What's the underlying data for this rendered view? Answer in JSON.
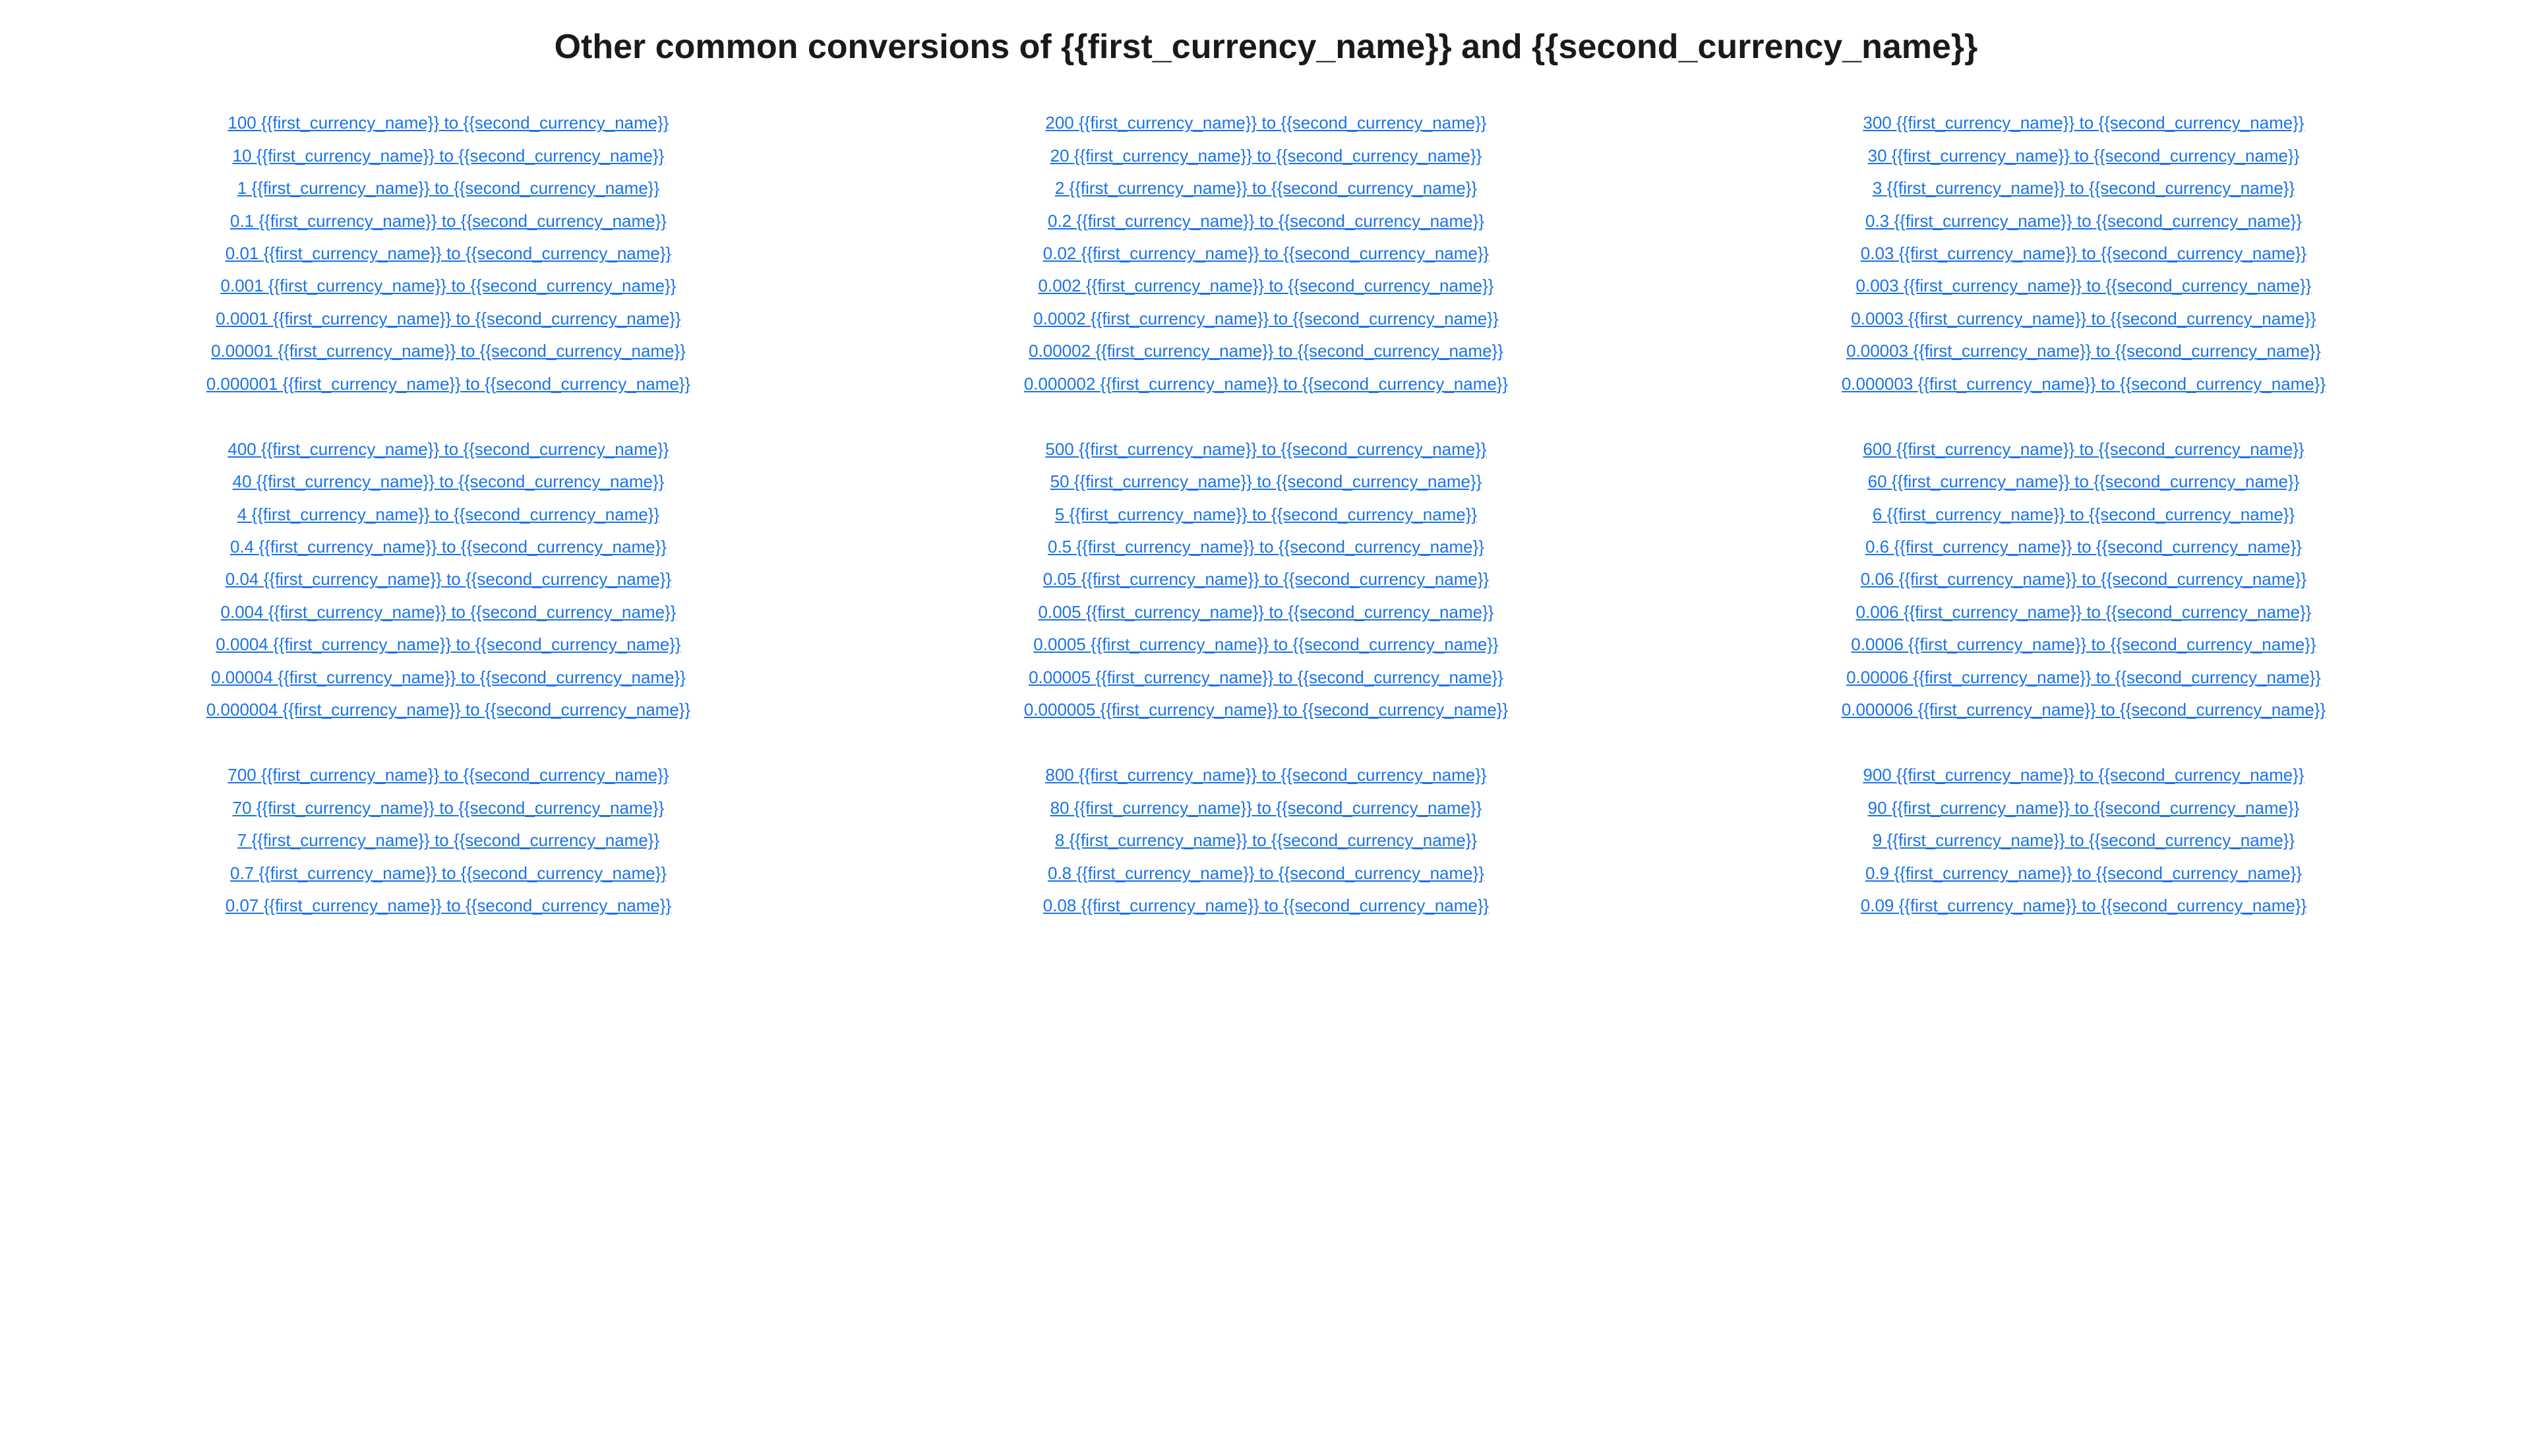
{
  "page": {
    "title": "Other common conversions of {{first_currency_name}} and {{second_currency_name}}"
  },
  "columns": [
    {
      "groups": [
        {
          "links": [
            "100 {{first_currency_name}} to {{second_currency_name}}",
            "10 {{first_currency_name}} to {{second_currency_name}}",
            "1 {{first_currency_name}} to {{second_currency_name}}",
            "0.1 {{first_currency_name}} to {{second_currency_name}}",
            "0.01 {{first_currency_name}} to {{second_currency_name}}",
            "0.001 {{first_currency_name}} to {{second_currency_name}}",
            "0.0001 {{first_currency_name}} to {{second_currency_name}}",
            "0.00001 {{first_currency_name}} to {{second_currency_name}}",
            "0.000001 {{first_currency_name}} to {{second_currency_name}}"
          ]
        },
        {
          "links": [
            "400 {{first_currency_name}} to {{second_currency_name}}",
            "40 {{first_currency_name}} to {{second_currency_name}}",
            "4 {{first_currency_name}} to {{second_currency_name}}",
            "0.4 {{first_currency_name}} to {{second_currency_name}}",
            "0.04 {{first_currency_name}} to {{second_currency_name}}",
            "0.004 {{first_currency_name}} to {{second_currency_name}}",
            "0.0004 {{first_currency_name}} to {{second_currency_name}}",
            "0.00004 {{first_currency_name}} to {{second_currency_name}}",
            "0.000004 {{first_currency_name}} to {{second_currency_name}}"
          ]
        },
        {
          "links": [
            "700 {{first_currency_name}} to {{second_currency_name}}",
            "70 {{first_currency_name}} to {{second_currency_name}}",
            "7 {{first_currency_name}} to {{second_currency_name}}",
            "0.7 {{first_currency_name}} to {{second_currency_name}}",
            "0.07 {{first_currency_name}} to {{second_currency_name}}"
          ]
        }
      ]
    },
    {
      "groups": [
        {
          "links": [
            "200 {{first_currency_name}} to {{second_currency_name}}",
            "20 {{first_currency_name}} to {{second_currency_name}}",
            "2 {{first_currency_name}} to {{second_currency_name}}",
            "0.2 {{first_currency_name}} to {{second_currency_name}}",
            "0.02 {{first_currency_name}} to {{second_currency_name}}",
            "0.002 {{first_currency_name}} to {{second_currency_name}}",
            "0.0002 {{first_currency_name}} to {{second_currency_name}}",
            "0.00002 {{first_currency_name}} to {{second_currency_name}}",
            "0.000002 {{first_currency_name}} to {{second_currency_name}}"
          ]
        },
        {
          "links": [
            "500 {{first_currency_name}} to {{second_currency_name}}",
            "50 {{first_currency_name}} to {{second_currency_name}}",
            "5 {{first_currency_name}} to {{second_currency_name}}",
            "0.5 {{first_currency_name}} to {{second_currency_name}}",
            "0.05 {{first_currency_name}} to {{second_currency_name}}",
            "0.005 {{first_currency_name}} to {{second_currency_name}}",
            "0.0005 {{first_currency_name}} to {{second_currency_name}}",
            "0.00005 {{first_currency_name}} to {{second_currency_name}}",
            "0.000005 {{first_currency_name}} to {{second_currency_name}}"
          ]
        },
        {
          "links": [
            "800 {{first_currency_name}} to {{second_currency_name}}",
            "80 {{first_currency_name}} to {{second_currency_name}}",
            "8 {{first_currency_name}} to {{second_currency_name}}",
            "0.8 {{first_currency_name}} to {{second_currency_name}}",
            "0.08 {{first_currency_name}} to {{second_currency_name}}"
          ]
        }
      ]
    },
    {
      "groups": [
        {
          "links": [
            "300 {{first_currency_name}} to {{second_currency_name}}",
            "30 {{first_currency_name}} to {{second_currency_name}}",
            "3 {{first_currency_name}} to {{second_currency_name}}",
            "0.3 {{first_currency_name}} to {{second_currency_name}}",
            "0.03 {{first_currency_name}} to {{second_currency_name}}",
            "0.003 {{first_currency_name}} to {{second_currency_name}}",
            "0.0003 {{first_currency_name}} to {{second_currency_name}}",
            "0.00003 {{first_currency_name}} to {{second_currency_name}}",
            "0.000003 {{first_currency_name}} to {{second_currency_name}}"
          ]
        },
        {
          "links": [
            "600 {{first_currency_name}} to {{second_currency_name}}",
            "60 {{first_currency_name}} to {{second_currency_name}}",
            "6 {{first_currency_name}} to {{second_currency_name}}",
            "0.6 {{first_currency_name}} to {{second_currency_name}}",
            "0.06 {{first_currency_name}} to {{second_currency_name}}",
            "0.006 {{first_currency_name}} to {{second_currency_name}}",
            "0.0006 {{first_currency_name}} to {{second_currency_name}}",
            "0.00006 {{first_currency_name}} to {{second_currency_name}}",
            "0.000006 {{first_currency_name}} to {{second_currency_name}}"
          ]
        },
        {
          "links": [
            "900 {{first_currency_name}} to {{second_currency_name}}",
            "90 {{first_currency_name}} to {{second_currency_name}}",
            "9 {{first_currency_name}} to {{second_currency_name}}",
            "0.9 {{first_currency_name}} to {{second_currency_name}}",
            "0.09 {{first_currency_name}} to {{second_currency_name}}"
          ]
        }
      ]
    }
  ]
}
